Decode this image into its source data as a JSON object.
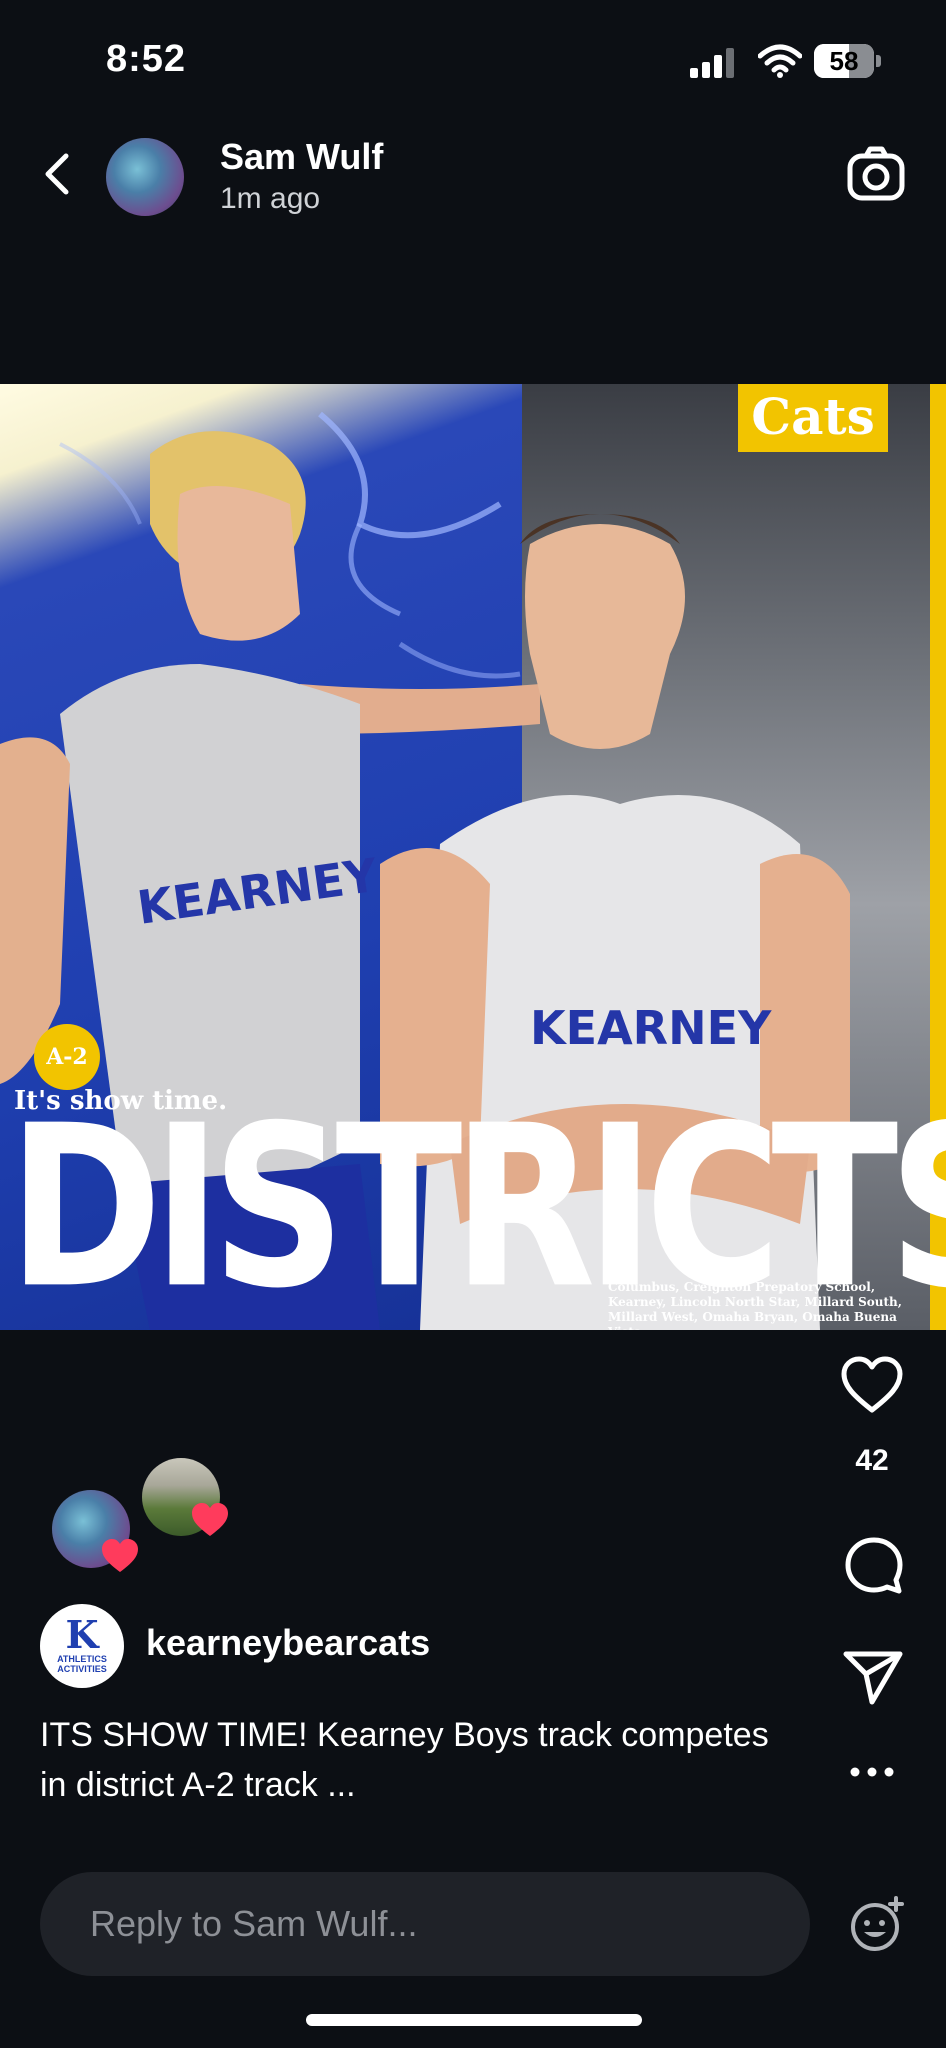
{
  "status_bar": {
    "time": "8:52",
    "battery": "58",
    "battery_level": 0.58
  },
  "header": {
    "username": "Sam Wulf",
    "time_ago": "1m ago"
  },
  "post": {
    "badge_cats": "Cats",
    "badge_a2": "A-2",
    "tagline": "It's show time.",
    "headline": "DISTRICTS",
    "jersey_text": "KEARNEY",
    "schools": "Columbus, Creighton Prepatory School, Kearney, Lincoln North Star, Millard South, Millard West, Omaha Bryan, Omaha Buena Vista"
  },
  "actions": {
    "like_count": "42"
  },
  "poster": {
    "name": "kearneybearcats",
    "avatar_letter": "K",
    "avatar_sub": "ATHLETICS ACTIVITIES"
  },
  "caption": "ITS SHOW TIME! Kearney Boys track competes in district A-2 track ...",
  "reply": {
    "placeholder": "Reply to Sam Wulf..."
  },
  "colors": {
    "background": "#0c0f14",
    "kearney_blue": "#1f3fb0",
    "accent_yellow": "#f2c400",
    "like_heart": "#ff3b5c"
  }
}
